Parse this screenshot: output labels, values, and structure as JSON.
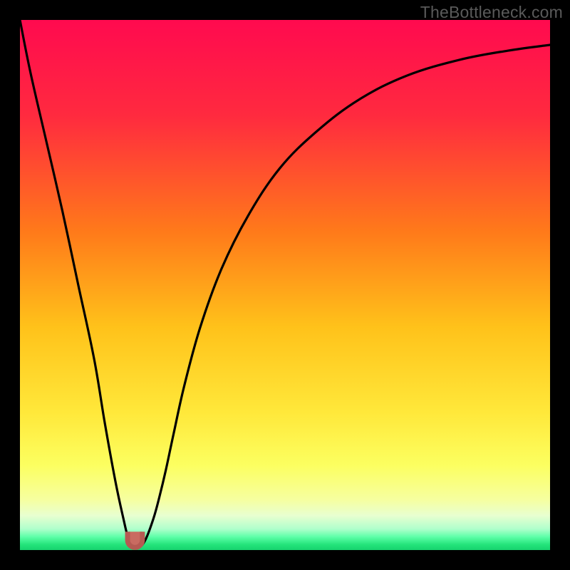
{
  "watermark": "TheBottleneck.com",
  "colors": {
    "frame": "#000000",
    "gradient_stops": [
      {
        "offset": 0.0,
        "color": "#ff0a4f"
      },
      {
        "offset": 0.18,
        "color": "#ff2a3f"
      },
      {
        "offset": 0.4,
        "color": "#ff7a1a"
      },
      {
        "offset": 0.58,
        "color": "#ffc21a"
      },
      {
        "offset": 0.74,
        "color": "#ffe83a"
      },
      {
        "offset": 0.84,
        "color": "#fcff60"
      },
      {
        "offset": 0.905,
        "color": "#f6ffa0"
      },
      {
        "offset": 0.935,
        "color": "#e8ffd0"
      },
      {
        "offset": 0.96,
        "color": "#b0ffcc"
      },
      {
        "offset": 0.975,
        "color": "#5dffa8"
      },
      {
        "offset": 0.99,
        "color": "#23e37a"
      },
      {
        "offset": 1.0,
        "color": "#17d36e"
      }
    ],
    "curve": "#000000",
    "trough_fill": "#c96b61",
    "trough_stroke": "#b55a52"
  },
  "chart_data": {
    "type": "line",
    "title": "",
    "xlabel": "",
    "ylabel": "",
    "xlim": [
      0,
      100
    ],
    "ylim": [
      0,
      100
    ],
    "grid": false,
    "legend": false,
    "series": [
      {
        "name": "bottleneck-curve",
        "x": [
          0,
          2,
          5,
          8,
          11,
          14,
          16,
          18,
          19.5,
          20.5,
          21.5,
          22.5,
          23.7,
          25.2,
          26.3,
          27.5,
          29,
          31,
          34,
          38,
          43,
          49,
          56,
          64,
          73,
          83,
          92,
          100
        ],
        "y": [
          100,
          90,
          77,
          64,
          50,
          36,
          24,
          13,
          6,
          2,
          0.5,
          0.5,
          2,
          6,
          10,
          15,
          22,
          31,
          42,
          53,
          63,
          72,
          79,
          85,
          89.5,
          92.5,
          94.2,
          95.3
        ]
      }
    ],
    "trough": {
      "x_range": [
        20.3,
        23.1
      ],
      "y": 0.5
    }
  }
}
